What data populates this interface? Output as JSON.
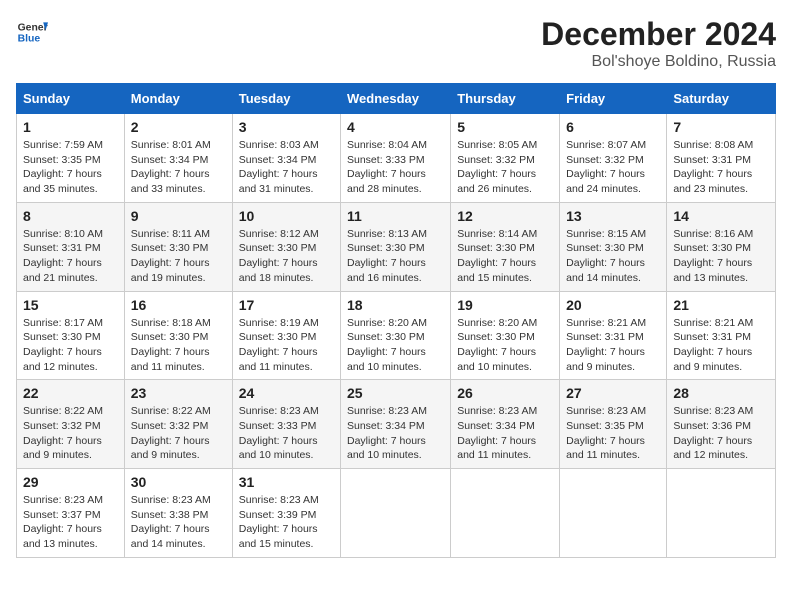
{
  "logo": {
    "general": "General",
    "blue": "Blue"
  },
  "title": "December 2024",
  "location": "Bol'shoye Boldino, Russia",
  "weekdays": [
    "Sunday",
    "Monday",
    "Tuesday",
    "Wednesday",
    "Thursday",
    "Friday",
    "Saturday"
  ],
  "weeks": [
    [
      {
        "day": "1",
        "sunrise": "7:59 AM",
        "sunset": "3:35 PM",
        "daylight": "7 hours and 35 minutes."
      },
      {
        "day": "2",
        "sunrise": "8:01 AM",
        "sunset": "3:34 PM",
        "daylight": "7 hours and 33 minutes."
      },
      {
        "day": "3",
        "sunrise": "8:03 AM",
        "sunset": "3:34 PM",
        "daylight": "7 hours and 31 minutes."
      },
      {
        "day": "4",
        "sunrise": "8:04 AM",
        "sunset": "3:33 PM",
        "daylight": "7 hours and 28 minutes."
      },
      {
        "day": "5",
        "sunrise": "8:05 AM",
        "sunset": "3:32 PM",
        "daylight": "7 hours and 26 minutes."
      },
      {
        "day": "6",
        "sunrise": "8:07 AM",
        "sunset": "3:32 PM",
        "daylight": "7 hours and 24 minutes."
      },
      {
        "day": "7",
        "sunrise": "8:08 AM",
        "sunset": "3:31 PM",
        "daylight": "7 hours and 23 minutes."
      }
    ],
    [
      {
        "day": "8",
        "sunrise": "8:10 AM",
        "sunset": "3:31 PM",
        "daylight": "7 hours and 21 minutes."
      },
      {
        "day": "9",
        "sunrise": "8:11 AM",
        "sunset": "3:30 PM",
        "daylight": "7 hours and 19 minutes."
      },
      {
        "day": "10",
        "sunrise": "8:12 AM",
        "sunset": "3:30 PM",
        "daylight": "7 hours and 18 minutes."
      },
      {
        "day": "11",
        "sunrise": "8:13 AM",
        "sunset": "3:30 PM",
        "daylight": "7 hours and 16 minutes."
      },
      {
        "day": "12",
        "sunrise": "8:14 AM",
        "sunset": "3:30 PM",
        "daylight": "7 hours and 15 minutes."
      },
      {
        "day": "13",
        "sunrise": "8:15 AM",
        "sunset": "3:30 PM",
        "daylight": "7 hours and 14 minutes."
      },
      {
        "day": "14",
        "sunrise": "8:16 AM",
        "sunset": "3:30 PM",
        "daylight": "7 hours and 13 minutes."
      }
    ],
    [
      {
        "day": "15",
        "sunrise": "8:17 AM",
        "sunset": "3:30 PM",
        "daylight": "7 hours and 12 minutes."
      },
      {
        "day": "16",
        "sunrise": "8:18 AM",
        "sunset": "3:30 PM",
        "daylight": "7 hours and 11 minutes."
      },
      {
        "day": "17",
        "sunrise": "8:19 AM",
        "sunset": "3:30 PM",
        "daylight": "7 hours and 11 minutes."
      },
      {
        "day": "18",
        "sunrise": "8:20 AM",
        "sunset": "3:30 PM",
        "daylight": "7 hours and 10 minutes."
      },
      {
        "day": "19",
        "sunrise": "8:20 AM",
        "sunset": "3:30 PM",
        "daylight": "7 hours and 10 minutes."
      },
      {
        "day": "20",
        "sunrise": "8:21 AM",
        "sunset": "3:31 PM",
        "daylight": "7 hours and 9 minutes."
      },
      {
        "day": "21",
        "sunrise": "8:21 AM",
        "sunset": "3:31 PM",
        "daylight": "7 hours and 9 minutes."
      }
    ],
    [
      {
        "day": "22",
        "sunrise": "8:22 AM",
        "sunset": "3:32 PM",
        "daylight": "7 hours and 9 minutes."
      },
      {
        "day": "23",
        "sunrise": "8:22 AM",
        "sunset": "3:32 PM",
        "daylight": "7 hours and 9 minutes."
      },
      {
        "day": "24",
        "sunrise": "8:23 AM",
        "sunset": "3:33 PM",
        "daylight": "7 hours and 10 minutes."
      },
      {
        "day": "25",
        "sunrise": "8:23 AM",
        "sunset": "3:34 PM",
        "daylight": "7 hours and 10 minutes."
      },
      {
        "day": "26",
        "sunrise": "8:23 AM",
        "sunset": "3:34 PM",
        "daylight": "7 hours and 11 minutes."
      },
      {
        "day": "27",
        "sunrise": "8:23 AM",
        "sunset": "3:35 PM",
        "daylight": "7 hours and 11 minutes."
      },
      {
        "day": "28",
        "sunrise": "8:23 AM",
        "sunset": "3:36 PM",
        "daylight": "7 hours and 12 minutes."
      }
    ],
    [
      {
        "day": "29",
        "sunrise": "8:23 AM",
        "sunset": "3:37 PM",
        "daylight": "7 hours and 13 minutes."
      },
      {
        "day": "30",
        "sunrise": "8:23 AM",
        "sunset": "3:38 PM",
        "daylight": "7 hours and 14 minutes."
      },
      {
        "day": "31",
        "sunrise": "8:23 AM",
        "sunset": "3:39 PM",
        "daylight": "7 hours and 15 minutes."
      },
      null,
      null,
      null,
      null
    ]
  ],
  "labels": {
    "sunrise": "Sunrise:",
    "sunset": "Sunset:",
    "daylight": "Daylight:"
  }
}
